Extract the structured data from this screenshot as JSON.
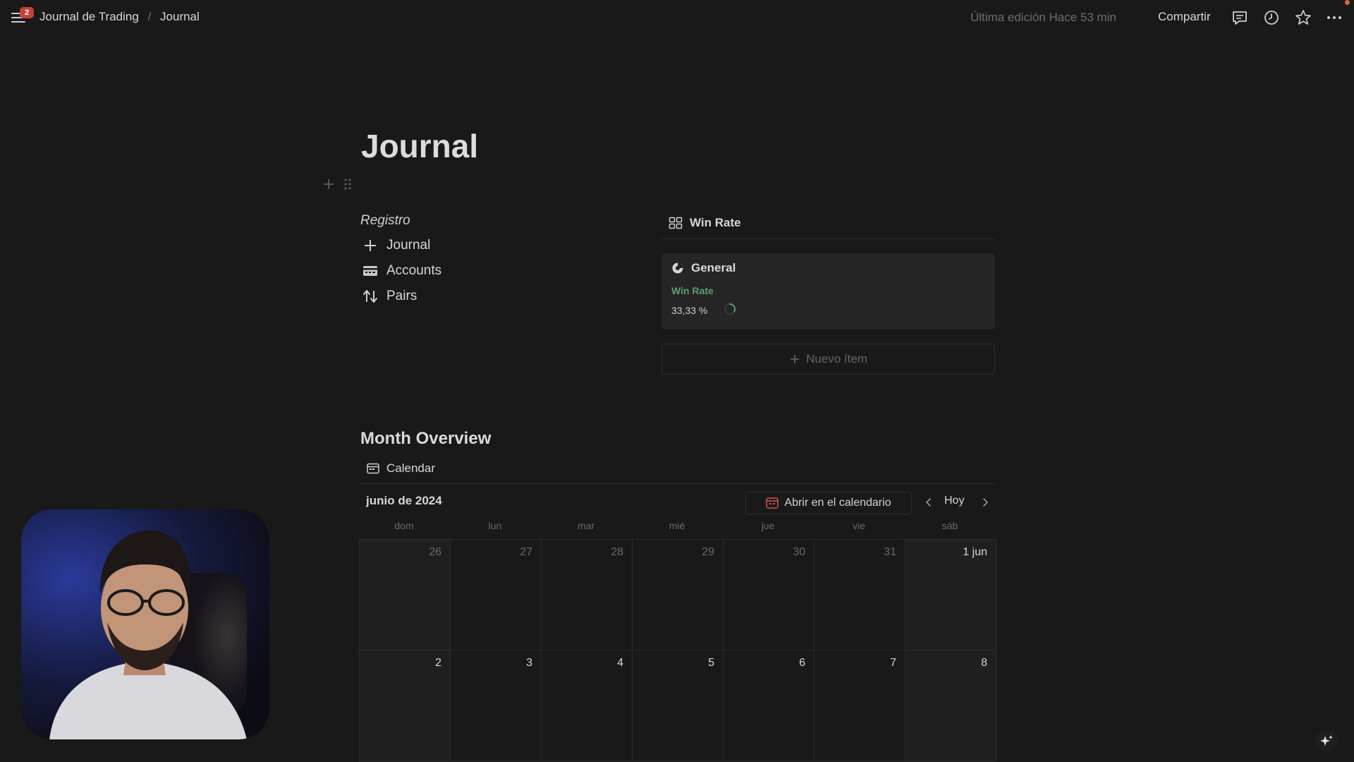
{
  "topbar": {
    "notification_count": "2",
    "breadcrumb": [
      "Journal de Trading",
      "Journal"
    ],
    "breadcrumb_separator": "/",
    "last_edit": "Última edición Hace 53 min",
    "share_label": "Compartir",
    "icons": [
      "menu-icon",
      "comment-icon",
      "clock-icon",
      "star-icon",
      "more-icon"
    ]
  },
  "page": {
    "title": "Journal",
    "block_controls": [
      "plus-icon",
      "drag-handle-icon"
    ]
  },
  "registro": {
    "label": "Registro",
    "links": [
      {
        "label": "Journal",
        "icon": "plus-icon"
      },
      {
        "label": "Accounts",
        "icon": "card-icon"
      },
      {
        "label": "Pairs",
        "icon": "swap-arrows-icon"
      }
    ]
  },
  "win_rate": {
    "view_label": "Win Rate",
    "card": {
      "title": "General",
      "property_label": "Win Rate",
      "property_value": "33,33 %",
      "progress": 0.3333
    },
    "new_item_label": "Nuevo ítem"
  },
  "month_overview": {
    "heading": "Month Overview",
    "view_label": "Calendar",
    "month_label": "junio de 2024",
    "open_calendar_label": "Abrir en el calendario",
    "today_label": "Hoy",
    "weekdays": [
      "dom",
      "lun",
      "mar",
      "mié",
      "jue",
      "vie",
      "sáb"
    ],
    "weeks": [
      [
        "26",
        "27",
        "28",
        "29",
        "30",
        "31",
        "1 jun"
      ],
      [
        "2",
        "3",
        "4",
        "5",
        "6",
        "7",
        "8"
      ]
    ],
    "outside_month_first_week": [
      true,
      true,
      true,
      true,
      true,
      true,
      false
    ]
  },
  "colors": {
    "background": "#191919",
    "card": "#252525",
    "win_rate_label": "#5f9e6e",
    "badge": "#c6403a"
  }
}
